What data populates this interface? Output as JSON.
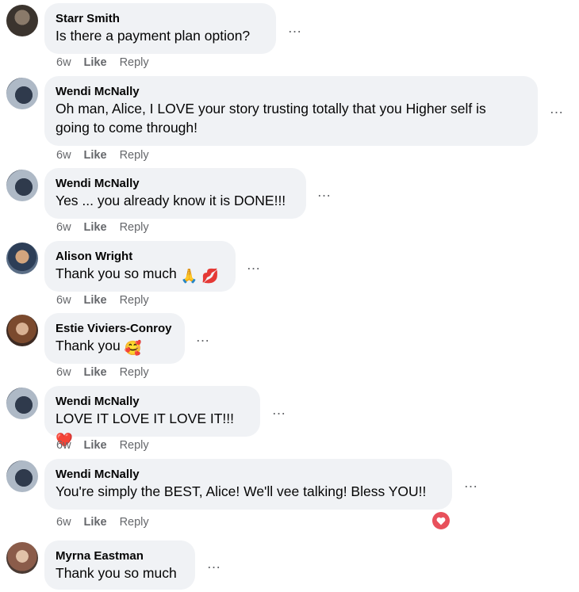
{
  "comments": [
    {
      "author": "Starr Smith",
      "text": "Is there a payment plan option?",
      "time": "6w",
      "like": "Like",
      "reply": "Reply",
      "emoji": ""
    },
    {
      "author": "Wendi McNally",
      "text_line1": "Oh man, Alice, I LOVE your story trusting totally that you Higher self is",
      "text_line2": "going to come through!",
      "time": "6w",
      "like": "Like",
      "reply": "Reply"
    },
    {
      "author": "Wendi McNally",
      "text": "Yes ... you already know it is DONE!!!",
      "time": "6w",
      "like": "Like",
      "reply": "Reply"
    },
    {
      "author": "Alison Wright",
      "text": "Thank you so much",
      "time": "6w",
      "like": "Like",
      "reply": "Reply",
      "emoji": "🙏 💋"
    },
    {
      "author": "Estie Viviers-Conroy",
      "text": "Thank you",
      "time": "6w",
      "like": "Like",
      "reply": "Reply",
      "emoji": "🥰"
    },
    {
      "author": "Wendi McNally",
      "text": "LOVE IT LOVE IT LOVE IT!!!",
      "time": "6w",
      "like": "Like",
      "reply": "Reply",
      "emoji": "❤️"
    },
    {
      "author": "Wendi McNally",
      "text": "You're simply the BEST, Alice! We'll vee talking! Bless YOU!!",
      "time": "6w",
      "like": "Like",
      "reply": "Reply",
      "reaction_icon": "heart-reaction-icon"
    },
    {
      "author": "Myrna Eastman",
      "text": "Thank you so much",
      "time": "",
      "like": "",
      "reply": ""
    }
  ],
  "more_icon": "…",
  "colors": {
    "bubble": "#f0f2f5",
    "meta": "#65676b",
    "heart": "#e8505b"
  }
}
